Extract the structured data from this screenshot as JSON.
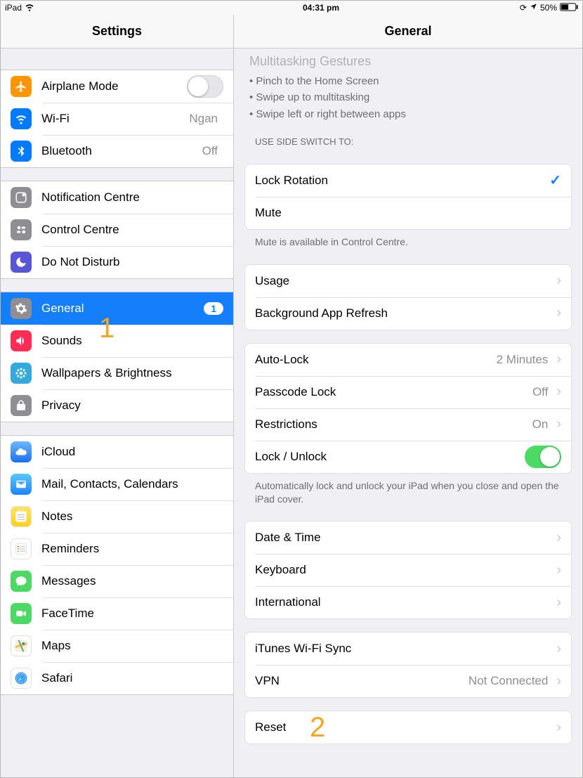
{
  "status": {
    "device": "iPad",
    "time": "04:31 pm",
    "battery_pct": "50%"
  },
  "sidebar": {
    "title": "Settings",
    "groups": [
      [
        {
          "icon": "airplane",
          "bg": "#ff9500",
          "label": "Airplane Mode",
          "value": "",
          "toggle": "off"
        },
        {
          "icon": "wifi",
          "bg": "#007aff",
          "label": "Wi-Fi",
          "value": "Ngan"
        },
        {
          "icon": "bluetooth",
          "bg": "#007aff",
          "label": "Bluetooth",
          "value": "Off"
        }
      ],
      [
        {
          "icon": "notif",
          "bg": "#8e8e93",
          "label": "Notification Centre"
        },
        {
          "icon": "control",
          "bg": "#8e8e93",
          "label": "Control Centre"
        },
        {
          "icon": "dnd",
          "bg": "#5856d6",
          "label": "Do Not Disturb"
        }
      ],
      [
        {
          "icon": "gear",
          "bg": "#8e8e93",
          "label": "General",
          "selected": true,
          "badge": "1"
        },
        {
          "icon": "sound",
          "bg": "#ff2d55",
          "label": "Sounds"
        },
        {
          "icon": "wallpaper",
          "bg": "#34aadc",
          "label": "Wallpapers & Brightness"
        },
        {
          "icon": "privacy",
          "bg": "#8e8e93",
          "label": "Privacy"
        }
      ],
      [
        {
          "icon": "icloud",
          "bg": "linear-gradient(#6fb7ff,#1a6ff0)",
          "label": "iCloud"
        },
        {
          "icon": "mail",
          "bg": "linear-gradient(#5ac8fa,#1d84ff)",
          "label": "Mail, Contacts, Calendars"
        },
        {
          "icon": "notes",
          "bg": "linear-gradient(#ffe46b,#ffd11a)",
          "label": "Notes"
        },
        {
          "icon": "reminders",
          "bg": "#fff",
          "label": "Reminders"
        },
        {
          "icon": "messages",
          "bg": "#4cd964",
          "label": "Messages"
        },
        {
          "icon": "facetime",
          "bg": "#4cd964",
          "label": "FaceTime"
        },
        {
          "icon": "maps",
          "bg": "#fff",
          "label": "Maps"
        },
        {
          "icon": "safari",
          "bg": "#fff",
          "label": "Safari"
        }
      ]
    ]
  },
  "detail": {
    "title": "General",
    "pre_title": "Multitasking Gestures",
    "pre_lines": [
      "• Pinch to the Home Screen",
      "• Swipe up to multitasking",
      "• Swipe left or right between apps"
    ],
    "side_switch_header": "USE SIDE SWITCH TO:",
    "side_switch": [
      {
        "label": "Lock Rotation",
        "checked": true
      },
      {
        "label": "Mute",
        "checked": false
      }
    ],
    "side_switch_footer": "Mute is available in Control Centre.",
    "usage_group": [
      {
        "label": "Usage"
      },
      {
        "label": "Background App Refresh"
      }
    ],
    "lock_group": [
      {
        "label": "Auto-Lock",
        "value": "2 Minutes"
      },
      {
        "label": "Passcode Lock",
        "value": "Off"
      },
      {
        "label": "Restrictions",
        "value": "On"
      },
      {
        "label": "Lock / Unlock",
        "toggle": "on"
      }
    ],
    "lock_footer": "Automatically lock and unlock your iPad when you close and open the iPad cover.",
    "intl_group": [
      {
        "label": "Date & Time"
      },
      {
        "label": "Keyboard"
      },
      {
        "label": "International"
      }
    ],
    "net_group": [
      {
        "label": "iTunes Wi-Fi Sync"
      },
      {
        "label": "VPN",
        "value": "Not Connected"
      }
    ],
    "reset_group": [
      {
        "label": "Reset"
      }
    ]
  },
  "annotations": {
    "one": "1",
    "two": "2"
  }
}
